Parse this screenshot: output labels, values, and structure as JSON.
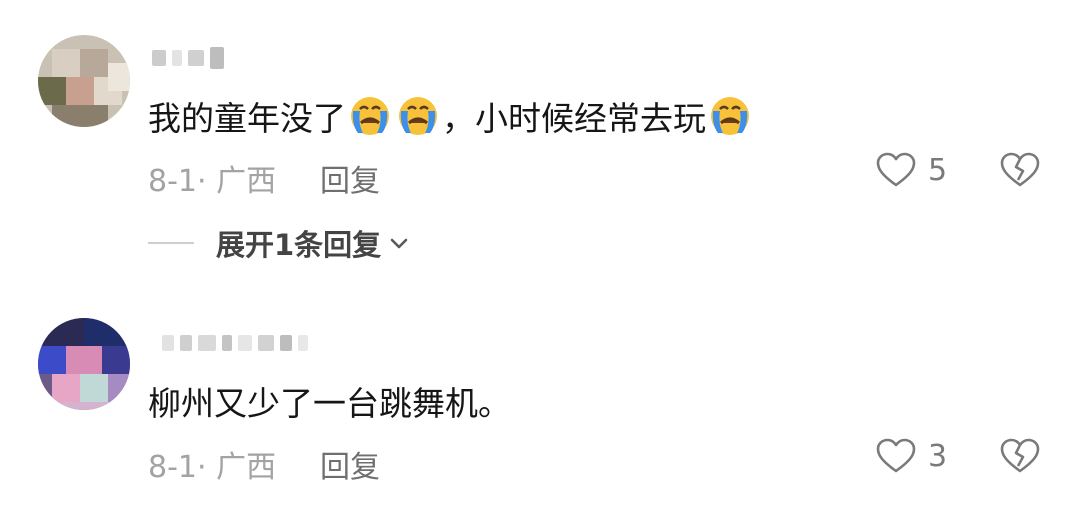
{
  "comments": [
    {
      "text_part1": "我的童年没了",
      "emoji_part": "😭😭",
      "text_part2": "，小时候经常去玩",
      "emoji_part2": "😭",
      "date_region": "8-1· 广西",
      "reply_label": "回复",
      "likes": "5",
      "expand_label": "展开1条回复"
    },
    {
      "text": "柳州又少了一台跳舞机。",
      "date_region": "8-1· 广西",
      "reply_label": "回复",
      "likes": "3"
    }
  ],
  "icons": {
    "like": "heart-outline-icon",
    "dislike": "broken-heart-icon",
    "expand": "chevron-down-icon",
    "emoji": "loudly-crying-face-emoji"
  },
  "colors": {
    "text": "#161616",
    "meta": "#a3a3a3",
    "reply": "#6f6f6f"
  }
}
